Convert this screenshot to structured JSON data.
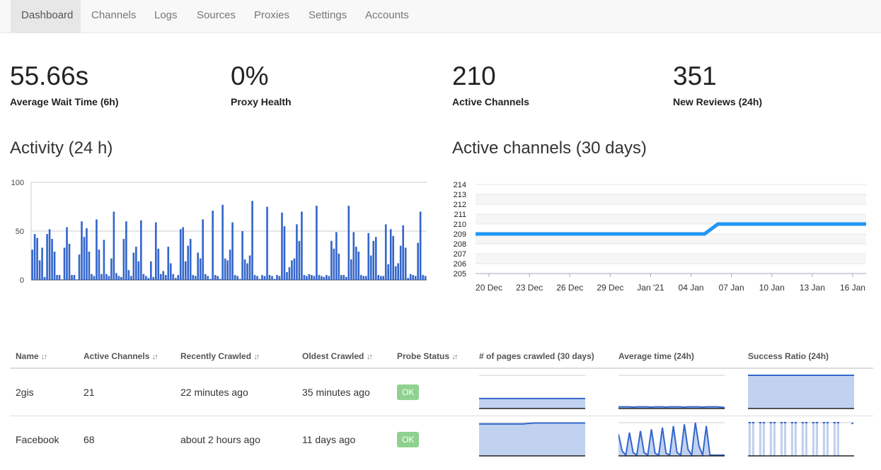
{
  "nav": {
    "items": [
      {
        "label": "Dashboard",
        "active": true
      },
      {
        "label": "Channels"
      },
      {
        "label": "Logs"
      },
      {
        "label": "Sources"
      },
      {
        "label": "Proxies"
      },
      {
        "label": "Settings"
      },
      {
        "label": "Accounts"
      }
    ]
  },
  "stats": [
    {
      "value": "55.66s",
      "label": "Average Wait Time (6h)"
    },
    {
      "value": "0%",
      "label": "Proxy Health"
    },
    {
      "value": "210",
      "label": "Active Channels"
    },
    {
      "value": "351",
      "label": "New Reviews (24h)"
    }
  ],
  "charts": {
    "activity_title": "Activity (24 h)",
    "active_title": "Active channels (30 days)"
  },
  "colors": {
    "bar": "#3366cc",
    "line": "#2196f3",
    "ok": "#8fd18f",
    "spark_fill": "#c1d2f0"
  },
  "chart_data": [
    {
      "type": "bar",
      "title": "Activity (24 h)",
      "ylim": [
        0,
        100
      ],
      "yticks": [
        0,
        50,
        100
      ],
      "values": [
        31,
        47,
        43,
        20,
        33,
        3,
        47,
        52,
        42,
        29,
        5,
        5,
        0,
        33,
        54,
        37,
        5,
        5,
        0,
        26,
        60,
        44,
        53,
        29,
        6,
        4,
        62,
        31,
        6,
        41,
        6,
        4,
        22,
        70,
        7,
        4,
        3,
        42,
        60,
        10,
        4,
        28,
        34,
        19,
        61,
        6,
        4,
        2,
        19,
        3,
        59,
        32,
        6,
        9,
        5,
        34,
        17,
        6,
        2,
        5,
        52,
        54,
        19,
        35,
        42,
        5,
        4,
        28,
        22,
        62,
        6,
        4,
        1,
        71,
        5,
        4,
        1,
        77,
        22,
        20,
        31,
        59,
        5,
        4,
        1,
        50,
        21,
        17,
        25,
        81,
        5,
        4,
        1,
        5,
        4,
        75,
        5,
        4,
        1,
        5,
        4,
        69,
        55,
        8,
        13,
        20,
        22,
        57,
        40,
        70,
        5,
        4,
        6,
        5,
        4,
        76,
        5,
        4,
        3,
        5,
        4,
        40,
        32,
        49,
        27,
        5,
        5,
        3,
        76,
        21,
        49,
        34,
        29,
        5,
        4,
        4,
        48,
        25,
        40,
        44,
        5,
        4,
        4,
        57,
        16,
        52,
        45,
        14,
        17,
        35,
        56,
        33,
        2,
        6,
        5,
        4,
        38,
        70,
        5,
        4
      ]
    },
    {
      "type": "line",
      "title": "Active channels (30 days)",
      "ylim": [
        205,
        214
      ],
      "yticks": [
        205,
        206,
        207,
        208,
        209,
        210,
        211,
        212,
        213,
        214
      ],
      "xticks": [
        "20 Dec",
        "23 Dec",
        "26 Dec",
        "29 Dec",
        "Jan '21",
        "04 Jan",
        "07 Jan",
        "10 Jan",
        "13 Jan",
        "16 Jan"
      ],
      "x": [
        "19 Dec",
        "05 Jan",
        "06 Jan",
        "17 Jan"
      ],
      "y": [
        209,
        209,
        210,
        210
      ]
    }
  ],
  "table": {
    "headers": [
      "Name",
      "Active Channels",
      "Recently Crawled",
      "Oldest Crawled",
      "Probe Status",
      "# of pages crawled (30 days)",
      "Average time (24h)",
      "Success Ratio (24h)"
    ],
    "rows": [
      {
        "name": "2gis",
        "active": "21",
        "recent": "22 minutes ago",
        "oldest": "35 minutes ago",
        "status": "OK",
        "pages": [
          0.3,
          0.3,
          0.3,
          0.3,
          0.3,
          0.3,
          0.3,
          0.3,
          0.3,
          0.3,
          0.3,
          0.3,
          0.3,
          0.3,
          0.3,
          0.3,
          0.3,
          0.3,
          0.3,
          0.3,
          0.3,
          0.3,
          0.3,
          0.3,
          0.3,
          0.3,
          0.3,
          0.3,
          0.3,
          0.3
        ],
        "avg": [
          0.05,
          0.05,
          0.05,
          0.05,
          0.04,
          0.05,
          0.05,
          0.05,
          0.05,
          0.04,
          0.05,
          0.05,
          0.05,
          0.04,
          0.05,
          0.05,
          0.05,
          0.05,
          0.04,
          0.05,
          0.05,
          0.05,
          0.05,
          0.04,
          0.05,
          0.05,
          0.05,
          0.05,
          0.04,
          0.03
        ],
        "success": [
          1,
          1,
          1,
          1,
          1,
          1,
          1,
          1,
          1,
          1,
          1,
          1,
          1,
          1,
          1,
          1,
          1,
          1,
          1,
          1,
          1,
          1,
          1,
          1,
          1,
          1,
          1,
          1,
          1,
          1
        ]
      },
      {
        "name": "Facebook",
        "active": "68",
        "recent": "about 2 hours ago",
        "oldest": "11 days ago",
        "status": "OK",
        "pages": [
          0.96,
          0.96,
          0.96,
          0.96,
          0.96,
          0.96,
          0.96,
          0.96,
          0.96,
          0.96,
          0.96,
          0.96,
          0.96,
          0.97,
          0.98,
          0.99,
          0.99,
          0.99,
          0.99,
          0.99,
          0.99,
          0.99,
          0.99,
          0.99,
          0.99,
          0.99,
          0.99,
          0.99,
          0.99,
          0.99
        ],
        "avg": [
          0.65,
          0.15,
          0.02,
          0.7,
          0.1,
          0.02,
          0.75,
          0.1,
          0.02,
          0.8,
          0.08,
          0.02,
          0.85,
          0.08,
          0.02,
          0.9,
          0.1,
          0.02,
          0.95,
          0.2,
          0.02,
          1.0,
          0.3,
          0.02,
          0.9,
          0.02,
          0.02,
          0.02,
          0.02,
          0.02
        ],
        "success": [
          1,
          1,
          0,
          1,
          1,
          0,
          1,
          1,
          0,
          1,
          1,
          0,
          1,
          1,
          0,
          1,
          1,
          0,
          1,
          1,
          0,
          1,
          1,
          0,
          1,
          1,
          0,
          0,
          0,
          0.98
        ]
      }
    ]
  }
}
